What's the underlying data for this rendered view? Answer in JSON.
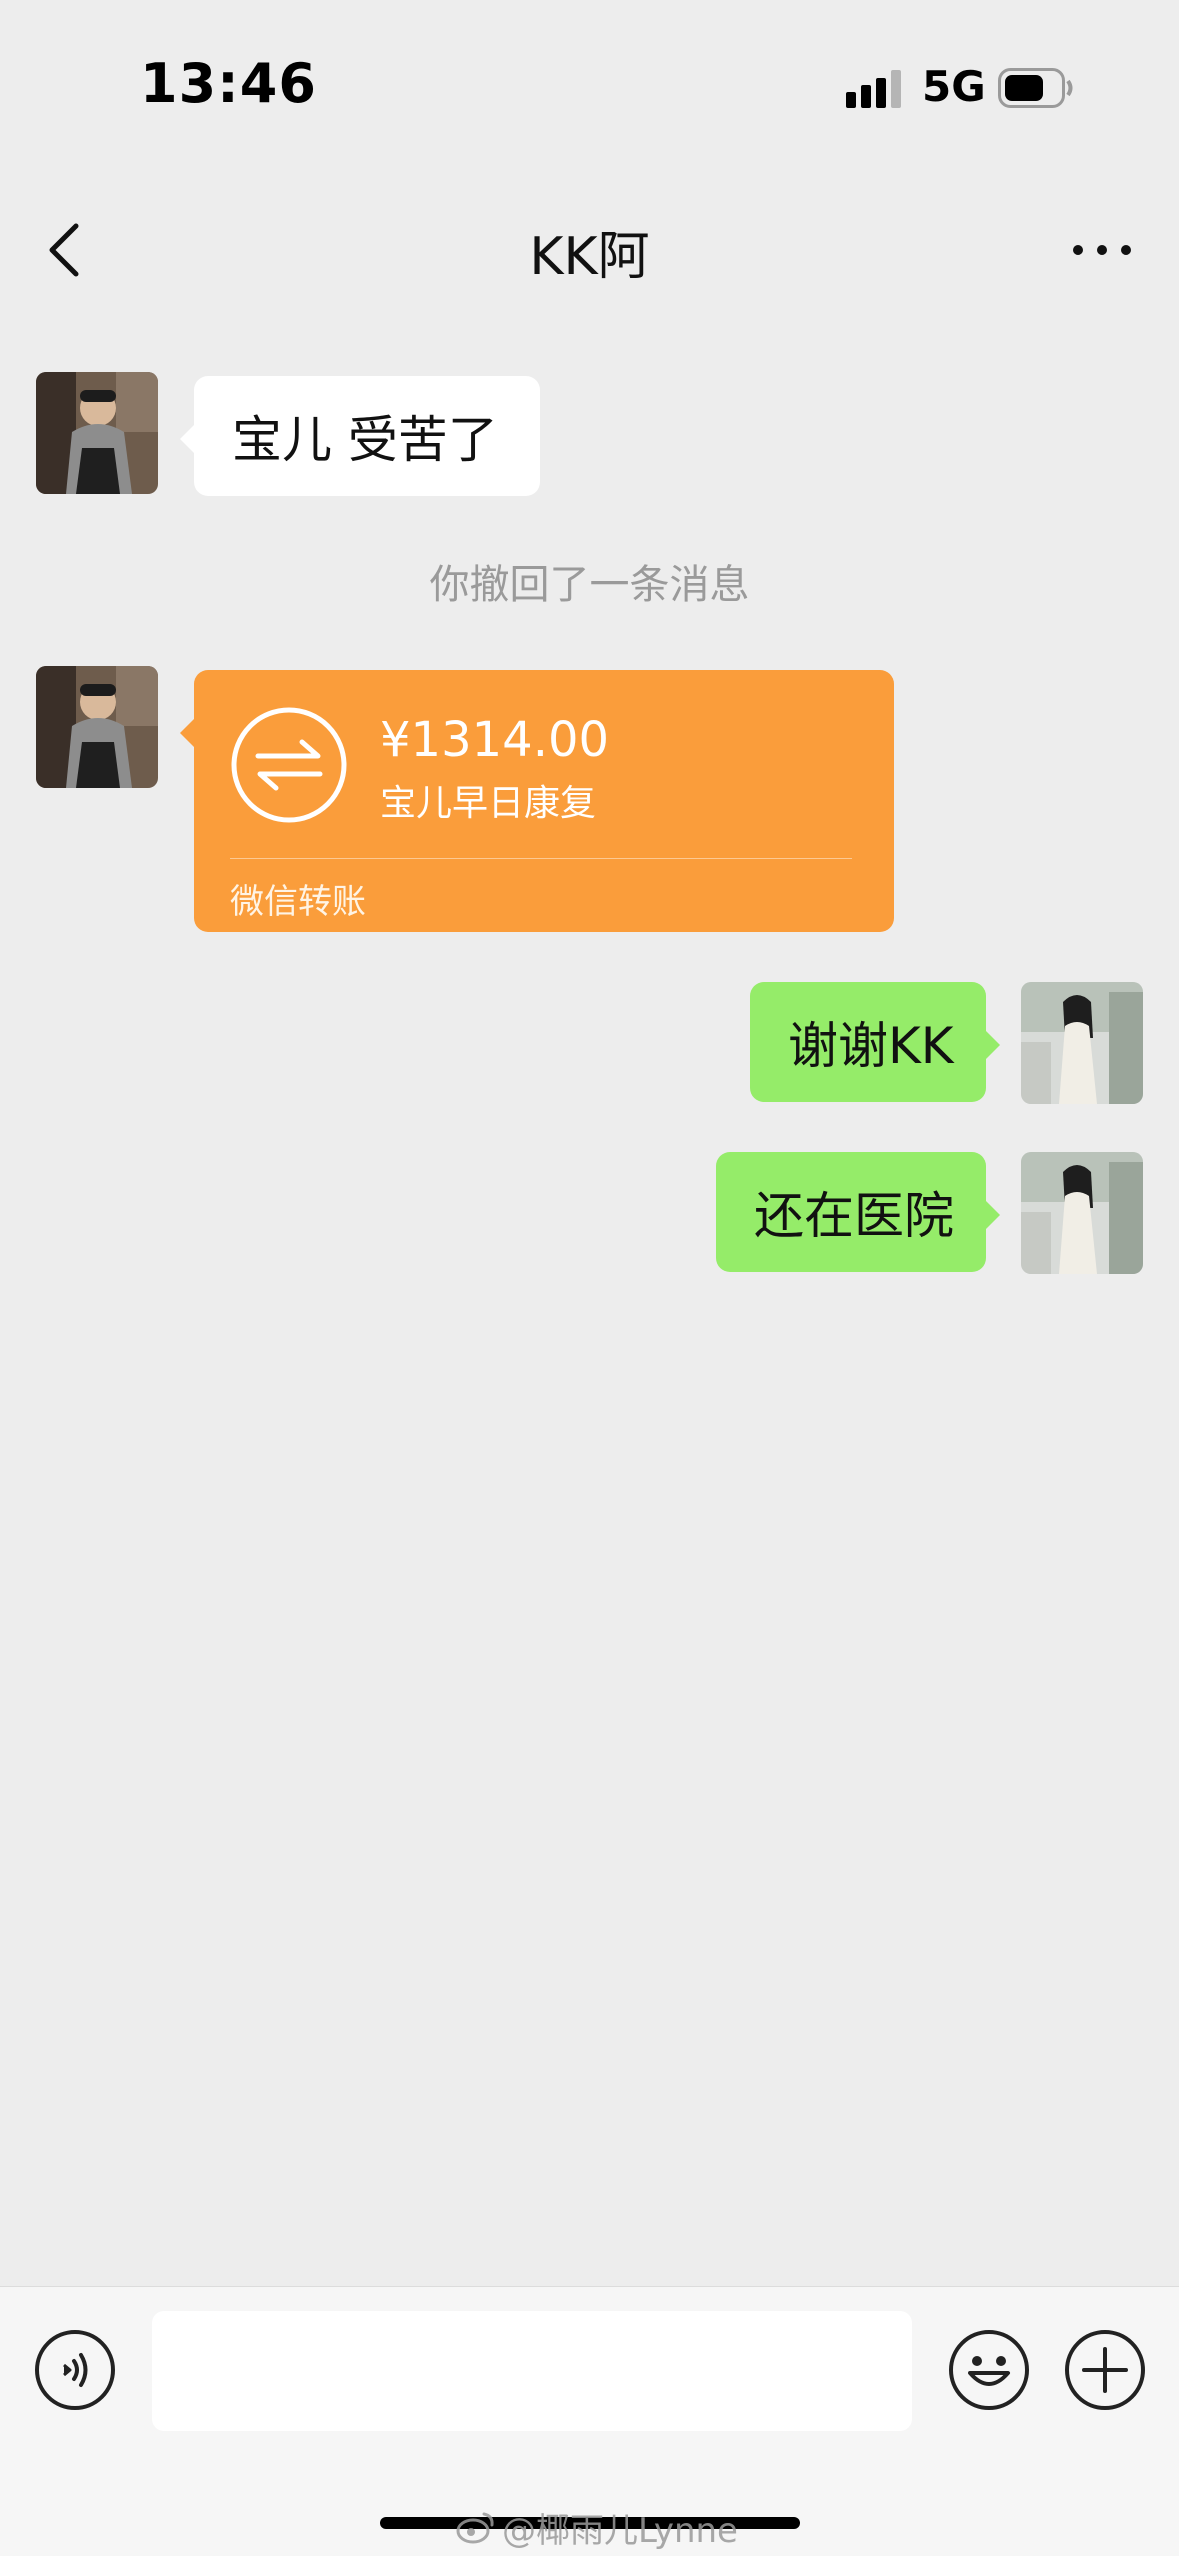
{
  "status_bar": {
    "time": "13:46",
    "network": "5G",
    "icons": [
      "signal-icon",
      "battery-icon"
    ]
  },
  "nav": {
    "title": "KK阿",
    "icons": [
      "back-icon",
      "more-icon"
    ]
  },
  "messages": [
    {
      "side": "left",
      "type": "text",
      "text": "宝儿 受苦了"
    },
    {
      "side": "center",
      "type": "system",
      "text": "你撤回了一条消息"
    },
    {
      "side": "left",
      "type": "transfer",
      "amount": "¥1314.00",
      "note": "宝儿早日康复",
      "label": "微信转账"
    },
    {
      "side": "right",
      "type": "text",
      "text": "谢谢KK"
    },
    {
      "side": "right",
      "type": "text",
      "text": "还在医院"
    }
  ],
  "input_bar": {
    "value": "",
    "icons": [
      "voice-icon",
      "emoji-icon",
      "plus-icon"
    ]
  },
  "watermark": "@椰雨儿Lynne",
  "colors": {
    "background": "#ededed",
    "incoming_bubble": "#ffffff",
    "outgoing_bubble": "#95ec69",
    "transfer_card": "#fa9d3b",
    "system_text": "#9a9a9a"
  }
}
